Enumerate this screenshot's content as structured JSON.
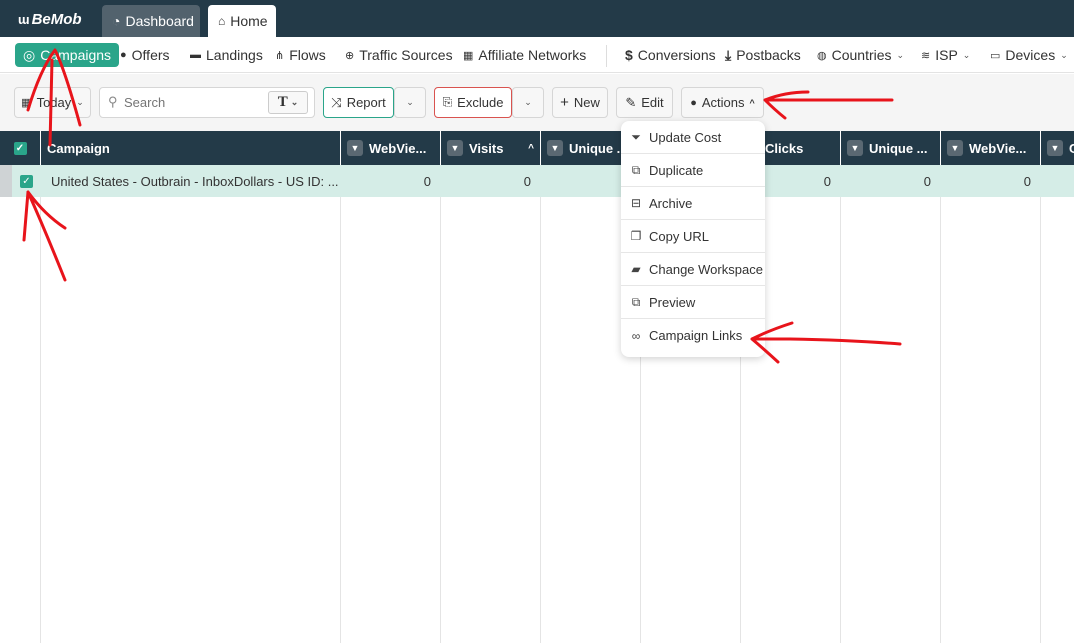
{
  "app": {
    "logo": "BeMob",
    "tabs": [
      {
        "label": "Dashboard",
        "icon": "gauge-icon",
        "active": false
      },
      {
        "label": "Home",
        "icon": "home-icon",
        "active": true
      }
    ]
  },
  "nav": {
    "items": [
      {
        "label": "Campaigns",
        "icon": "target-icon",
        "active": true
      },
      {
        "label": "Offers",
        "icon": "dollar-badge-icon"
      },
      {
        "label": "Landings",
        "icon": "window-icon"
      },
      {
        "label": "Flows",
        "icon": "sitemap-icon"
      },
      {
        "label": "Traffic Sources",
        "icon": "globe-icon"
      },
      {
        "label": "Affiliate Networks",
        "icon": "network-icon"
      },
      {
        "label": "Conversions",
        "icon": "dollar-icon"
      },
      {
        "label": "Postbacks",
        "icon": "download-icon"
      },
      {
        "label": "Countries",
        "icon": "globe-icon",
        "dropdown": true
      },
      {
        "label": "ISP",
        "icon": "wifi-icon",
        "dropdown": true
      },
      {
        "label": "Devices",
        "icon": "laptop-icon",
        "dropdown": true
      }
    ]
  },
  "toolbar": {
    "date_label": "Today",
    "search_placeholder": "Search",
    "search_type": "T",
    "report_label": "Report",
    "exclude_label": "Exclude",
    "new_label": "New",
    "edit_label": "Edit",
    "actions_label": "Actions"
  },
  "actions_menu": {
    "items": [
      {
        "label": "Update Cost",
        "icon": "filter-dollar-icon"
      },
      {
        "label": "Duplicate",
        "icon": "copy-icon"
      },
      {
        "label": "Archive",
        "icon": "archive-icon"
      },
      {
        "label": "Copy URL",
        "icon": "clone-icon"
      },
      {
        "label": "Change Workspace",
        "icon": "folders-icon"
      },
      {
        "label": "Preview",
        "icon": "external-link-icon"
      },
      {
        "label": "Campaign Links",
        "icon": "link-icon"
      }
    ]
  },
  "table": {
    "columns": [
      "Campaign",
      "WebVie...",
      "Visits",
      "Unique ...",
      "Clicks",
      "Clicks",
      "Unique ...",
      "WebVie...",
      "C"
    ],
    "rows": [
      {
        "selected": true,
        "campaign": "United States - Outbrain - InboxDollars - US ID: ...",
        "values": [
          "0",
          "0",
          "",
          "",
          "0",
          "0",
          "0",
          ""
        ]
      }
    ]
  },
  "colors": {
    "accent": "#2aa58a",
    "header_bg": "#233a48",
    "selected_row": "#d5ede7",
    "annotation": "#e8141b"
  }
}
